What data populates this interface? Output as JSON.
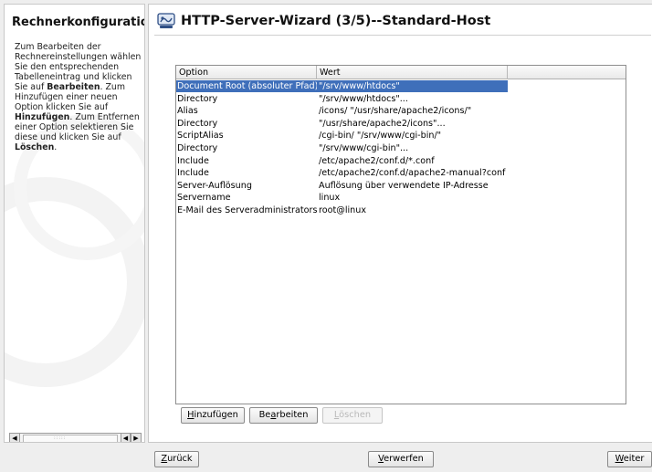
{
  "help": {
    "title": "Rechnerkonfiguration",
    "segments": [
      {
        "text": "Zum Bearbeiten der Rechnereinstellungen wählen Sie den entsprechenden Tabelleneintrag und klicken Sie auf ",
        "bold": false
      },
      {
        "text": "Bearbeiten",
        "bold": true
      },
      {
        "text": ". Zum Hinzufügen einer neuen Option klicken Sie auf ",
        "bold": false
      },
      {
        "text": "Hinzufügen",
        "bold": true
      },
      {
        "text": ". Zum Entfernen einer Option selektieren Sie diese und klicken Sie auf ",
        "bold": false
      },
      {
        "text": "Löschen",
        "bold": true
      },
      {
        "text": ".",
        "bold": false
      }
    ]
  },
  "wizard": {
    "title": "HTTP-Server-Wizard (3/5)--Standard-Host"
  },
  "table": {
    "columns": [
      "Option",
      "Wert"
    ],
    "rows": [
      {
        "option": "Document Root (absoluter Pfad)",
        "value": "\"/srv/www/htdocs\"",
        "selected": true
      },
      {
        "option": "Directory",
        "value": "\"/srv/www/htdocs\"...",
        "selected": false
      },
      {
        "option": "Alias",
        "value": "/icons/ \"/usr/share/apache2/icons/\"",
        "selected": false
      },
      {
        "option": "Directory",
        "value": "\"/usr/share/apache2/icons\"...",
        "selected": false
      },
      {
        "option": "ScriptAlias",
        "value": "/cgi-bin/ \"/srv/www/cgi-bin/\"",
        "selected": false
      },
      {
        "option": "Directory",
        "value": "\"/srv/www/cgi-bin\"...",
        "selected": false
      },
      {
        "option": "Include",
        "value": "/etc/apache2/conf.d/*.conf",
        "selected": false
      },
      {
        "option": "Include",
        "value": "/etc/apache2/conf.d/apache2-manual?conf",
        "selected": false
      },
      {
        "option": "Server-Auflösung",
        "value": "Auflösung über verwendete IP-Adresse",
        "selected": false
      },
      {
        "option": "Servername",
        "value": "linux",
        "selected": false
      },
      {
        "option": "E-Mail des Serveradministrators",
        "value": "root@linux",
        "selected": false
      }
    ]
  },
  "actions": {
    "add": {
      "mnemonic": "H",
      "rest": "inzufügen"
    },
    "edit": {
      "pre": "Be",
      "mnemonic": "a",
      "rest": "rbeiten"
    },
    "delete": {
      "mnemonic": "L",
      "rest": "öschen"
    }
  },
  "nav": {
    "back": {
      "mnemonic": "Z",
      "rest": "urück"
    },
    "discard": {
      "mnemonic": "V",
      "rest": "erwerfen"
    },
    "next": {
      "mnemonic": "W",
      "rest": "eiter"
    }
  },
  "colors": {
    "selection": "#3f6fba",
    "panel_bg": "#ffffff",
    "window_bg": "#eeeeee"
  },
  "icons": {
    "wizard": "network-server-icon",
    "scroll_left": "arrow-left-icon",
    "scroll_right": "arrow-right-icon"
  }
}
